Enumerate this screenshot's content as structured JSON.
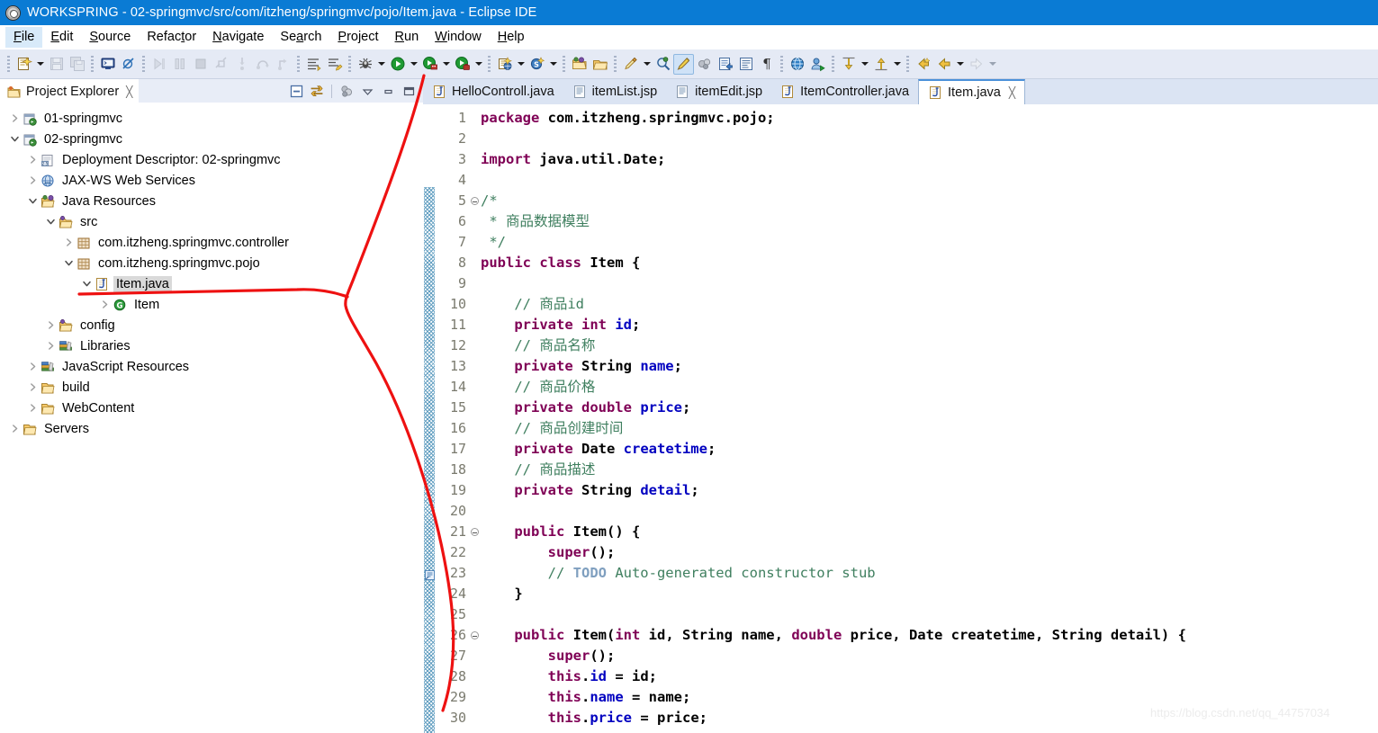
{
  "window": {
    "title": "WORKSPRING - 02-springmvc/src/com/itzheng/springmvc/pojo/Item.java - Eclipse IDE",
    "icon": "eclipse-icon",
    "titlebar_color": "#0a7bd4"
  },
  "menubar": {
    "items": [
      {
        "label": "File",
        "mnemonic": "F",
        "active": true
      },
      {
        "label": "Edit",
        "mnemonic": "E",
        "active": false
      },
      {
        "label": "Source",
        "mnemonic": "S",
        "active": false
      },
      {
        "label": "Refactor",
        "mnemonic": "t",
        "active": false
      },
      {
        "label": "Navigate",
        "mnemonic": "N",
        "active": false
      },
      {
        "label": "Search",
        "mnemonic": "a",
        "active": false
      },
      {
        "label": "Project",
        "mnemonic": "P",
        "active": false
      },
      {
        "label": "Run",
        "mnemonic": "R",
        "active": false
      },
      {
        "label": "Window",
        "mnemonic": "W",
        "active": false
      },
      {
        "label": "Help",
        "mnemonic": "H",
        "active": false
      }
    ]
  },
  "toolbar": {
    "background": "#e5eaf5",
    "buttons": [
      {
        "name": "new-wizard-icon",
        "kind": "new",
        "enabled": true,
        "dropdown": true
      },
      {
        "name": "save-icon",
        "kind": "save",
        "enabled": false,
        "dropdown": false
      },
      {
        "name": "save-all-icon",
        "kind": "saveall",
        "enabled": false,
        "dropdown": false
      },
      {
        "name": "console-icon",
        "kind": "console",
        "enabled": true,
        "dropdown": false
      },
      {
        "name": "skip-breakpoints-icon",
        "kind": "skipbp",
        "enabled": true,
        "dropdown": false
      },
      {
        "name": "resume-icon",
        "kind": "resume",
        "enabled": false,
        "dropdown": false
      },
      {
        "name": "suspend-icon",
        "kind": "suspend",
        "enabled": false,
        "dropdown": false
      },
      {
        "name": "terminate-icon",
        "kind": "terminate",
        "enabled": false,
        "dropdown": false
      },
      {
        "name": "disconnect-icon",
        "kind": "disconnect",
        "enabled": false,
        "dropdown": false
      },
      {
        "name": "step-into-icon",
        "kind": "stepinto",
        "enabled": false,
        "dropdown": false
      },
      {
        "name": "step-over-icon",
        "kind": "stepover",
        "enabled": false,
        "dropdown": false
      },
      {
        "name": "step-return-icon",
        "kind": "stepreturn",
        "enabled": false,
        "dropdown": false
      },
      {
        "name": "next-annotation-icon",
        "kind": "nextannot",
        "enabled": true,
        "dropdown": false
      },
      {
        "name": "last-edit-icon",
        "kind": "lastedit",
        "enabled": true,
        "dropdown": false
      },
      {
        "name": "debug-icon",
        "kind": "debug",
        "enabled": true,
        "dropdown": true
      },
      {
        "name": "run-icon",
        "kind": "run",
        "enabled": true,
        "dropdown": true
      },
      {
        "name": "run-server-icon",
        "kind": "runserver",
        "enabled": true,
        "dropdown": true
      },
      {
        "name": "profile-icon",
        "kind": "profile",
        "enabled": true,
        "dropdown": true
      },
      {
        "name": "new-java-project-icon",
        "kind": "newjavaprj",
        "enabled": true,
        "dropdown": true
      },
      {
        "name": "new-class-icon",
        "kind": "newclass",
        "enabled": true,
        "dropdown": true
      },
      {
        "name": "open-type-icon",
        "kind": "opentype",
        "enabled": true,
        "dropdown": false
      },
      {
        "name": "open-task-icon",
        "kind": "opentask",
        "enabled": true,
        "dropdown": false
      },
      {
        "name": "quickfix-icon",
        "kind": "quickfix",
        "enabled": true,
        "dropdown": true
      },
      {
        "name": "search-icon",
        "kind": "search",
        "enabled": true,
        "dropdown": false
      },
      {
        "name": "toggle-markoccurrences-icon",
        "kind": "markocc",
        "enabled": true,
        "dropdown": false,
        "selected": true
      },
      {
        "name": "link-icon",
        "kind": "link",
        "enabled": true,
        "dropdown": false
      },
      {
        "name": "open-external-icon",
        "kind": "openext",
        "enabled": true,
        "dropdown": false
      },
      {
        "name": "show-whitespace-icon",
        "kind": "whitespace",
        "enabled": true,
        "dropdown": false
      },
      {
        "name": "pilcrow-icon",
        "kind": "pilcrow",
        "enabled": true,
        "dropdown": false
      },
      {
        "name": "web-browser-icon",
        "kind": "browser",
        "enabled": true,
        "dropdown": false
      },
      {
        "name": "run-as-icon",
        "kind": "runas",
        "enabled": true,
        "dropdown": false
      },
      {
        "name": "prev-edit-icon",
        "kind": "prevedit",
        "enabled": true,
        "dropdown": true
      },
      {
        "name": "next-edit-icon",
        "kind": "nextedit",
        "enabled": true,
        "dropdown": true
      },
      {
        "name": "back-history-icon",
        "kind": "backhist",
        "enabled": true,
        "dropdown": false
      },
      {
        "name": "back-icon",
        "kind": "back",
        "enabled": true,
        "dropdown": true
      },
      {
        "name": "forward-icon",
        "kind": "forward",
        "enabled": false,
        "dropdown": true
      }
    ]
  },
  "project_explorer": {
    "tab_label": "Project Explorer",
    "tab_icon": "project-explorer-icon",
    "close_glyph": "╳",
    "view_actions": [
      {
        "name": "collapse-all-icon"
      },
      {
        "name": "link-with-editor-icon"
      },
      {
        "name": "filter-icon"
      },
      {
        "name": "view-menu-icon"
      },
      {
        "name": "minimize-icon"
      },
      {
        "name": "maximize-icon"
      }
    ],
    "tree": [
      {
        "label": "01-springmvc",
        "indent": 0,
        "twisty": "collapsed",
        "icon": "web-project-icon",
        "selected": false
      },
      {
        "label": "02-springmvc",
        "indent": 0,
        "twisty": "expanded",
        "icon": "web-project-icon",
        "selected": false
      },
      {
        "label": "Deployment Descriptor: 02-springmvc",
        "indent": 1,
        "twisty": "collapsed",
        "icon": "deployment-descriptor-icon",
        "selected": false
      },
      {
        "label": "JAX-WS Web Services",
        "indent": 1,
        "twisty": "collapsed",
        "icon": "jaxws-icon",
        "selected": false
      },
      {
        "label": "Java Resources",
        "indent": 1,
        "twisty": "expanded",
        "icon": "java-resources-icon",
        "selected": false
      },
      {
        "label": "src",
        "indent": 2,
        "twisty": "expanded",
        "icon": "source-folder-icon",
        "selected": false
      },
      {
        "label": "com.itzheng.springmvc.controller",
        "indent": 3,
        "twisty": "collapsed",
        "icon": "package-icon",
        "selected": false
      },
      {
        "label": "com.itzheng.springmvc.pojo",
        "indent": 3,
        "twisty": "expanded",
        "icon": "package-icon",
        "selected": false
      },
      {
        "label": "Item.java",
        "indent": 4,
        "twisty": "expanded",
        "icon": "java-file-icon",
        "selected": true
      },
      {
        "label": "Item",
        "indent": 5,
        "twisty": "collapsed",
        "icon": "java-class-icon",
        "selected": false
      },
      {
        "label": "config",
        "indent": 2,
        "twisty": "collapsed",
        "icon": "source-folder-icon",
        "selected": false
      },
      {
        "label": "Libraries",
        "indent": 2,
        "twisty": "collapsed",
        "icon": "libraries-icon",
        "selected": false
      },
      {
        "label": "JavaScript Resources",
        "indent": 1,
        "twisty": "collapsed",
        "icon": "libraries-icon",
        "selected": false
      },
      {
        "label": "build",
        "indent": 1,
        "twisty": "collapsed",
        "icon": "folder-icon",
        "selected": false
      },
      {
        "label": "WebContent",
        "indent": 1,
        "twisty": "collapsed",
        "icon": "folder-icon",
        "selected": false
      },
      {
        "label": "Servers",
        "indent": 0,
        "twisty": "collapsed",
        "icon": "folder-icon",
        "selected": false
      }
    ]
  },
  "editor": {
    "tabs": [
      {
        "label": "HelloControll.java",
        "icon": "java-file-icon",
        "active": false,
        "closable": false
      },
      {
        "label": "itemList.jsp",
        "icon": "jsp-file-icon",
        "active": false,
        "closable": false
      },
      {
        "label": "itemEdit.jsp",
        "icon": "jsp-file-icon",
        "active": false,
        "closable": false
      },
      {
        "label": "ItemController.java",
        "icon": "java-file-icon",
        "active": false,
        "closable": false
      },
      {
        "label": "Item.java",
        "icon": "java-file-icon",
        "active": true,
        "closable": true,
        "close_glyph": "╳"
      }
    ],
    "first_visible_line": 1,
    "marker_bar_start_line": 5,
    "fold_lines": [
      5,
      21,
      26
    ],
    "task_marker_lines": [
      23
    ],
    "lines": [
      {
        "n": 1,
        "tokens": [
          {
            "t": "package",
            "c": "k"
          },
          {
            "t": " com.itzheng.springmvc.pojo;",
            "c": "t"
          }
        ]
      },
      {
        "n": 2,
        "tokens": []
      },
      {
        "n": 3,
        "tokens": [
          {
            "t": "import",
            "c": "k"
          },
          {
            "t": " java.util.Date;",
            "c": "t"
          }
        ]
      },
      {
        "n": 4,
        "tokens": []
      },
      {
        "n": 5,
        "tokens": [
          {
            "t": "/*",
            "c": "c"
          }
        ]
      },
      {
        "n": 6,
        "tokens": [
          {
            "t": " * 商品数据模型",
            "c": "c"
          }
        ]
      },
      {
        "n": 7,
        "tokens": [
          {
            "t": " */",
            "c": "c"
          }
        ]
      },
      {
        "n": 8,
        "tokens": [
          {
            "t": "public",
            "c": "k"
          },
          {
            "t": " ",
            "c": "p"
          },
          {
            "t": "class",
            "c": "k"
          },
          {
            "t": " Item {",
            "c": "t"
          }
        ]
      },
      {
        "n": 9,
        "tokens": []
      },
      {
        "n": 10,
        "tokens": [
          {
            "t": "    // 商品id",
            "c": "c"
          }
        ]
      },
      {
        "n": 11,
        "tokens": [
          {
            "t": "    ",
            "c": "p"
          },
          {
            "t": "private int",
            "c": "k"
          },
          {
            "t": " ",
            "c": "p"
          },
          {
            "t": "id",
            "c": "f"
          },
          {
            "t": ";",
            "c": "t"
          }
        ]
      },
      {
        "n": 12,
        "tokens": [
          {
            "t": "    // 商品名称",
            "c": "c"
          }
        ]
      },
      {
        "n": 13,
        "tokens": [
          {
            "t": "    ",
            "c": "p"
          },
          {
            "t": "private",
            "c": "k"
          },
          {
            "t": " String ",
            "c": "t"
          },
          {
            "t": "name",
            "c": "f"
          },
          {
            "t": ";",
            "c": "t"
          }
        ]
      },
      {
        "n": 14,
        "tokens": [
          {
            "t": "    // 商品价格",
            "c": "c"
          }
        ]
      },
      {
        "n": 15,
        "tokens": [
          {
            "t": "    ",
            "c": "p"
          },
          {
            "t": "private double",
            "c": "k"
          },
          {
            "t": " ",
            "c": "p"
          },
          {
            "t": "price",
            "c": "f"
          },
          {
            "t": ";",
            "c": "t"
          }
        ]
      },
      {
        "n": 16,
        "tokens": [
          {
            "t": "    // 商品创建时间",
            "c": "c"
          }
        ]
      },
      {
        "n": 17,
        "tokens": [
          {
            "t": "    ",
            "c": "p"
          },
          {
            "t": "private",
            "c": "k"
          },
          {
            "t": " Date ",
            "c": "t"
          },
          {
            "t": "createtime",
            "c": "f"
          },
          {
            "t": ";",
            "c": "t"
          }
        ]
      },
      {
        "n": 18,
        "tokens": [
          {
            "t": "    // 商品描述",
            "c": "c"
          }
        ]
      },
      {
        "n": 19,
        "tokens": [
          {
            "t": "    ",
            "c": "p"
          },
          {
            "t": "private",
            "c": "k"
          },
          {
            "t": " String ",
            "c": "t"
          },
          {
            "t": "detail",
            "c": "f"
          },
          {
            "t": ";",
            "c": "t"
          }
        ]
      },
      {
        "n": 20,
        "tokens": []
      },
      {
        "n": 21,
        "tokens": [
          {
            "t": "    ",
            "c": "p"
          },
          {
            "t": "public",
            "c": "k"
          },
          {
            "t": " Item() {",
            "c": "t"
          }
        ]
      },
      {
        "n": 22,
        "tokens": [
          {
            "t": "        ",
            "c": "p"
          },
          {
            "t": "super",
            "c": "k"
          },
          {
            "t": "();",
            "c": "t"
          }
        ]
      },
      {
        "n": 23,
        "tokens": [
          {
            "t": "        // ",
            "c": "c"
          },
          {
            "t": "TODO",
            "c": "td"
          },
          {
            "t": " Auto-generated constructor stub",
            "c": "c"
          }
        ]
      },
      {
        "n": 24,
        "tokens": [
          {
            "t": "    }",
            "c": "t"
          }
        ]
      },
      {
        "n": 25,
        "tokens": []
      },
      {
        "n": 26,
        "tokens": [
          {
            "t": "    ",
            "c": "p"
          },
          {
            "t": "public",
            "c": "k"
          },
          {
            "t": " Item(",
            "c": "t"
          },
          {
            "t": "int",
            "c": "k"
          },
          {
            "t": " id, String name, ",
            "c": "t"
          },
          {
            "t": "double",
            "c": "k"
          },
          {
            "t": " price, Date createtime, String detail) {",
            "c": "t"
          }
        ]
      },
      {
        "n": 27,
        "tokens": [
          {
            "t": "        ",
            "c": "p"
          },
          {
            "t": "super",
            "c": "k"
          },
          {
            "t": "();",
            "c": "t"
          }
        ]
      },
      {
        "n": 28,
        "tokens": [
          {
            "t": "        ",
            "c": "p"
          },
          {
            "t": "this",
            "c": "k"
          },
          {
            "t": ".",
            "c": "t"
          },
          {
            "t": "id",
            "c": "f"
          },
          {
            "t": " = id;",
            "c": "t"
          }
        ]
      },
      {
        "n": 29,
        "tokens": [
          {
            "t": "        ",
            "c": "p"
          },
          {
            "t": "this",
            "c": "k"
          },
          {
            "t": ".",
            "c": "t"
          },
          {
            "t": "name",
            "c": "f"
          },
          {
            "t": " = name;",
            "c": "t"
          }
        ]
      },
      {
        "n": 30,
        "tokens": [
          {
            "t": "        ",
            "c": "p"
          },
          {
            "t": "this",
            "c": "k"
          },
          {
            "t": ".",
            "c": "t"
          },
          {
            "t": "price",
            "c": "f"
          },
          {
            "t": " = price;",
            "c": "t"
          }
        ]
      }
    ]
  },
  "annotation": {
    "color": "#ee1111",
    "description": "hand-drawn red arc from editor area pointing left to Item.java node"
  },
  "watermark": {
    "text": "https://blog.csdn.net/qq_44757034"
  }
}
